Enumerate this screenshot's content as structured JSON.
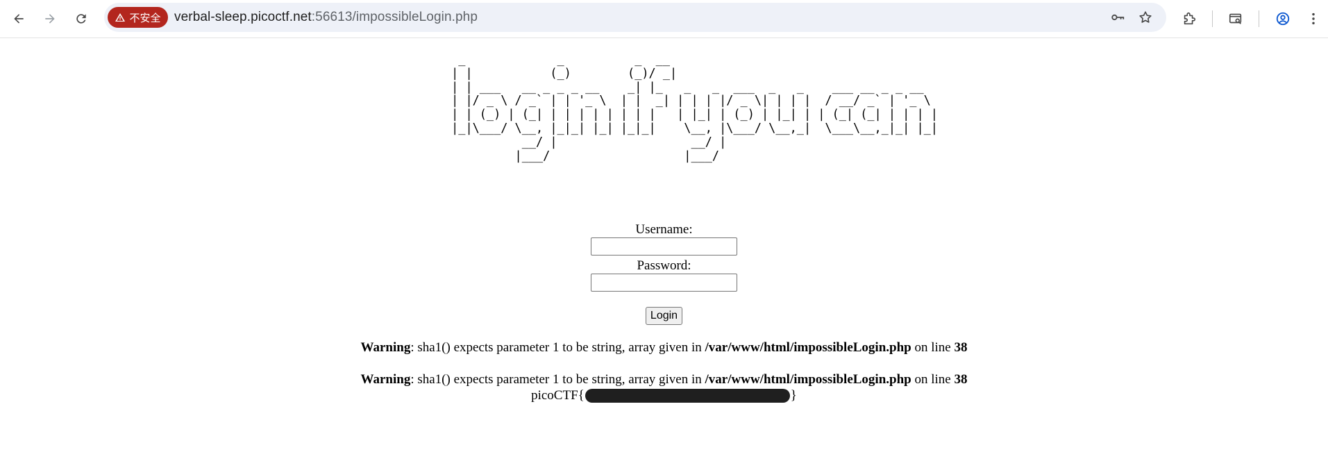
{
  "browser": {
    "security_chip_label": "不安全",
    "url_host": "verbal-sleep.picoctf.net",
    "url_rest": ":56613/impossibleLogin.php"
  },
  "page": {
    "ascii_art": "  _             _          _  __\n | |           (_)        (_)/ _|\n | | ___   __ _ _ _ __    _| |_   _   _  ___  _   _    ___ __ _ _ __\n | |/ _ \\ / _` | | '_ \\  | |  _| | | | |/ _ \\| | | |  / __/ _` | '_ \\\n | | (_) | (_| | | | | | | | |   | |_| | (_) | |_| | | (_| (_| | | | |\n |_|\\___/ \\__, |_|_| |_| |_|_|    \\__, |\\___/ \\__,_|  \\___\\__,_|_| |_|\n           __/ |                   __/ |\n          |___/                   |___/",
    "username_label": "Username:",
    "password_label": "Password:",
    "login_button": "Login",
    "warnings": [
      {
        "prefix": "Warning",
        "message": ": sha1() expects parameter 1 to be string, array given in ",
        "file": "/var/www/html/impossibleLogin.php",
        "on_line": " on line ",
        "line": "38"
      },
      {
        "prefix": "Warning",
        "message": ": sha1() expects parameter 1 to be string, array given in ",
        "file": "/var/www/html/impossibleLogin.php",
        "on_line": " on line ",
        "line": "38"
      }
    ],
    "flag_prefix": "picoCTF{",
    "flag_suffix": "}"
  }
}
